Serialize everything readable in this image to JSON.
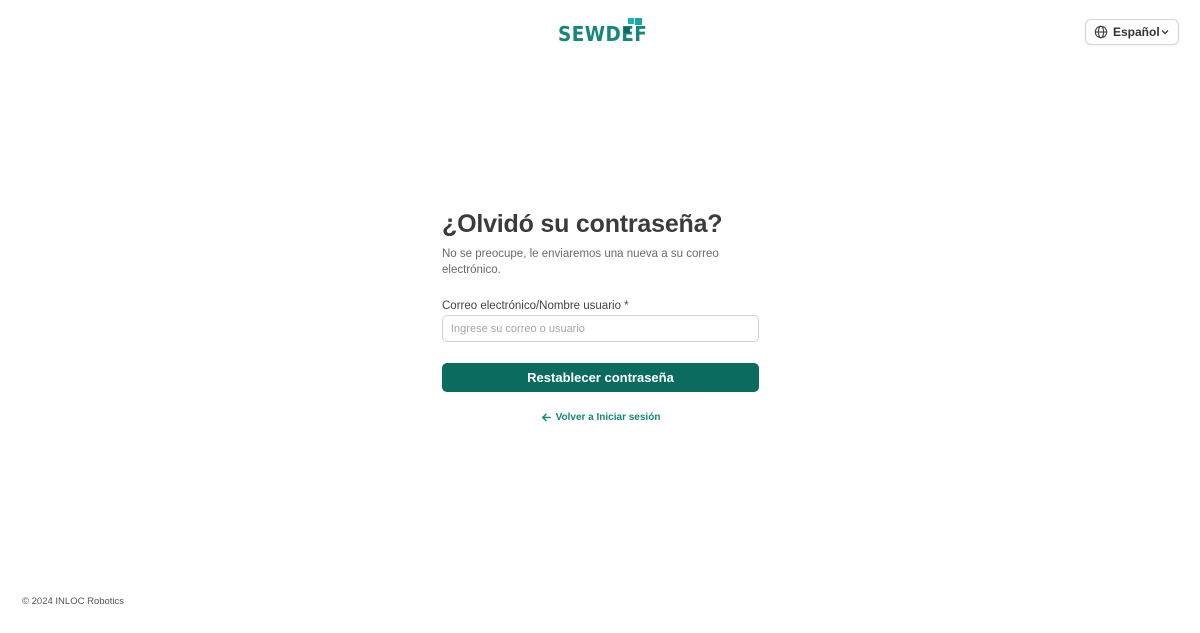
{
  "brand": {
    "logo_text": "SEWDEF",
    "primary_color": "#0b6b5e",
    "accent_color": "#17877a",
    "mark_colors": [
      "#1bb0c4",
      "#17877a"
    ]
  },
  "language_selector": {
    "icon": "globe-icon",
    "label": "Español",
    "chevron": "chevron-down-icon"
  },
  "form": {
    "title": "¿Olvidó su contraseña?",
    "subtitle": "No se preocupe, le enviaremos una nueva a su correo electrónico.",
    "field_label": "Correo electrónico/Nombre usuario *",
    "field_value": "",
    "field_placeholder": "Ingrese su correo o usuario",
    "submit_label": "Restablecer contraseña",
    "back_icon": "arrow-left-icon",
    "back_label": "Volver a Iniciar sesión"
  },
  "footer": {
    "copyright": "© 2024 INLOC Robotics"
  }
}
